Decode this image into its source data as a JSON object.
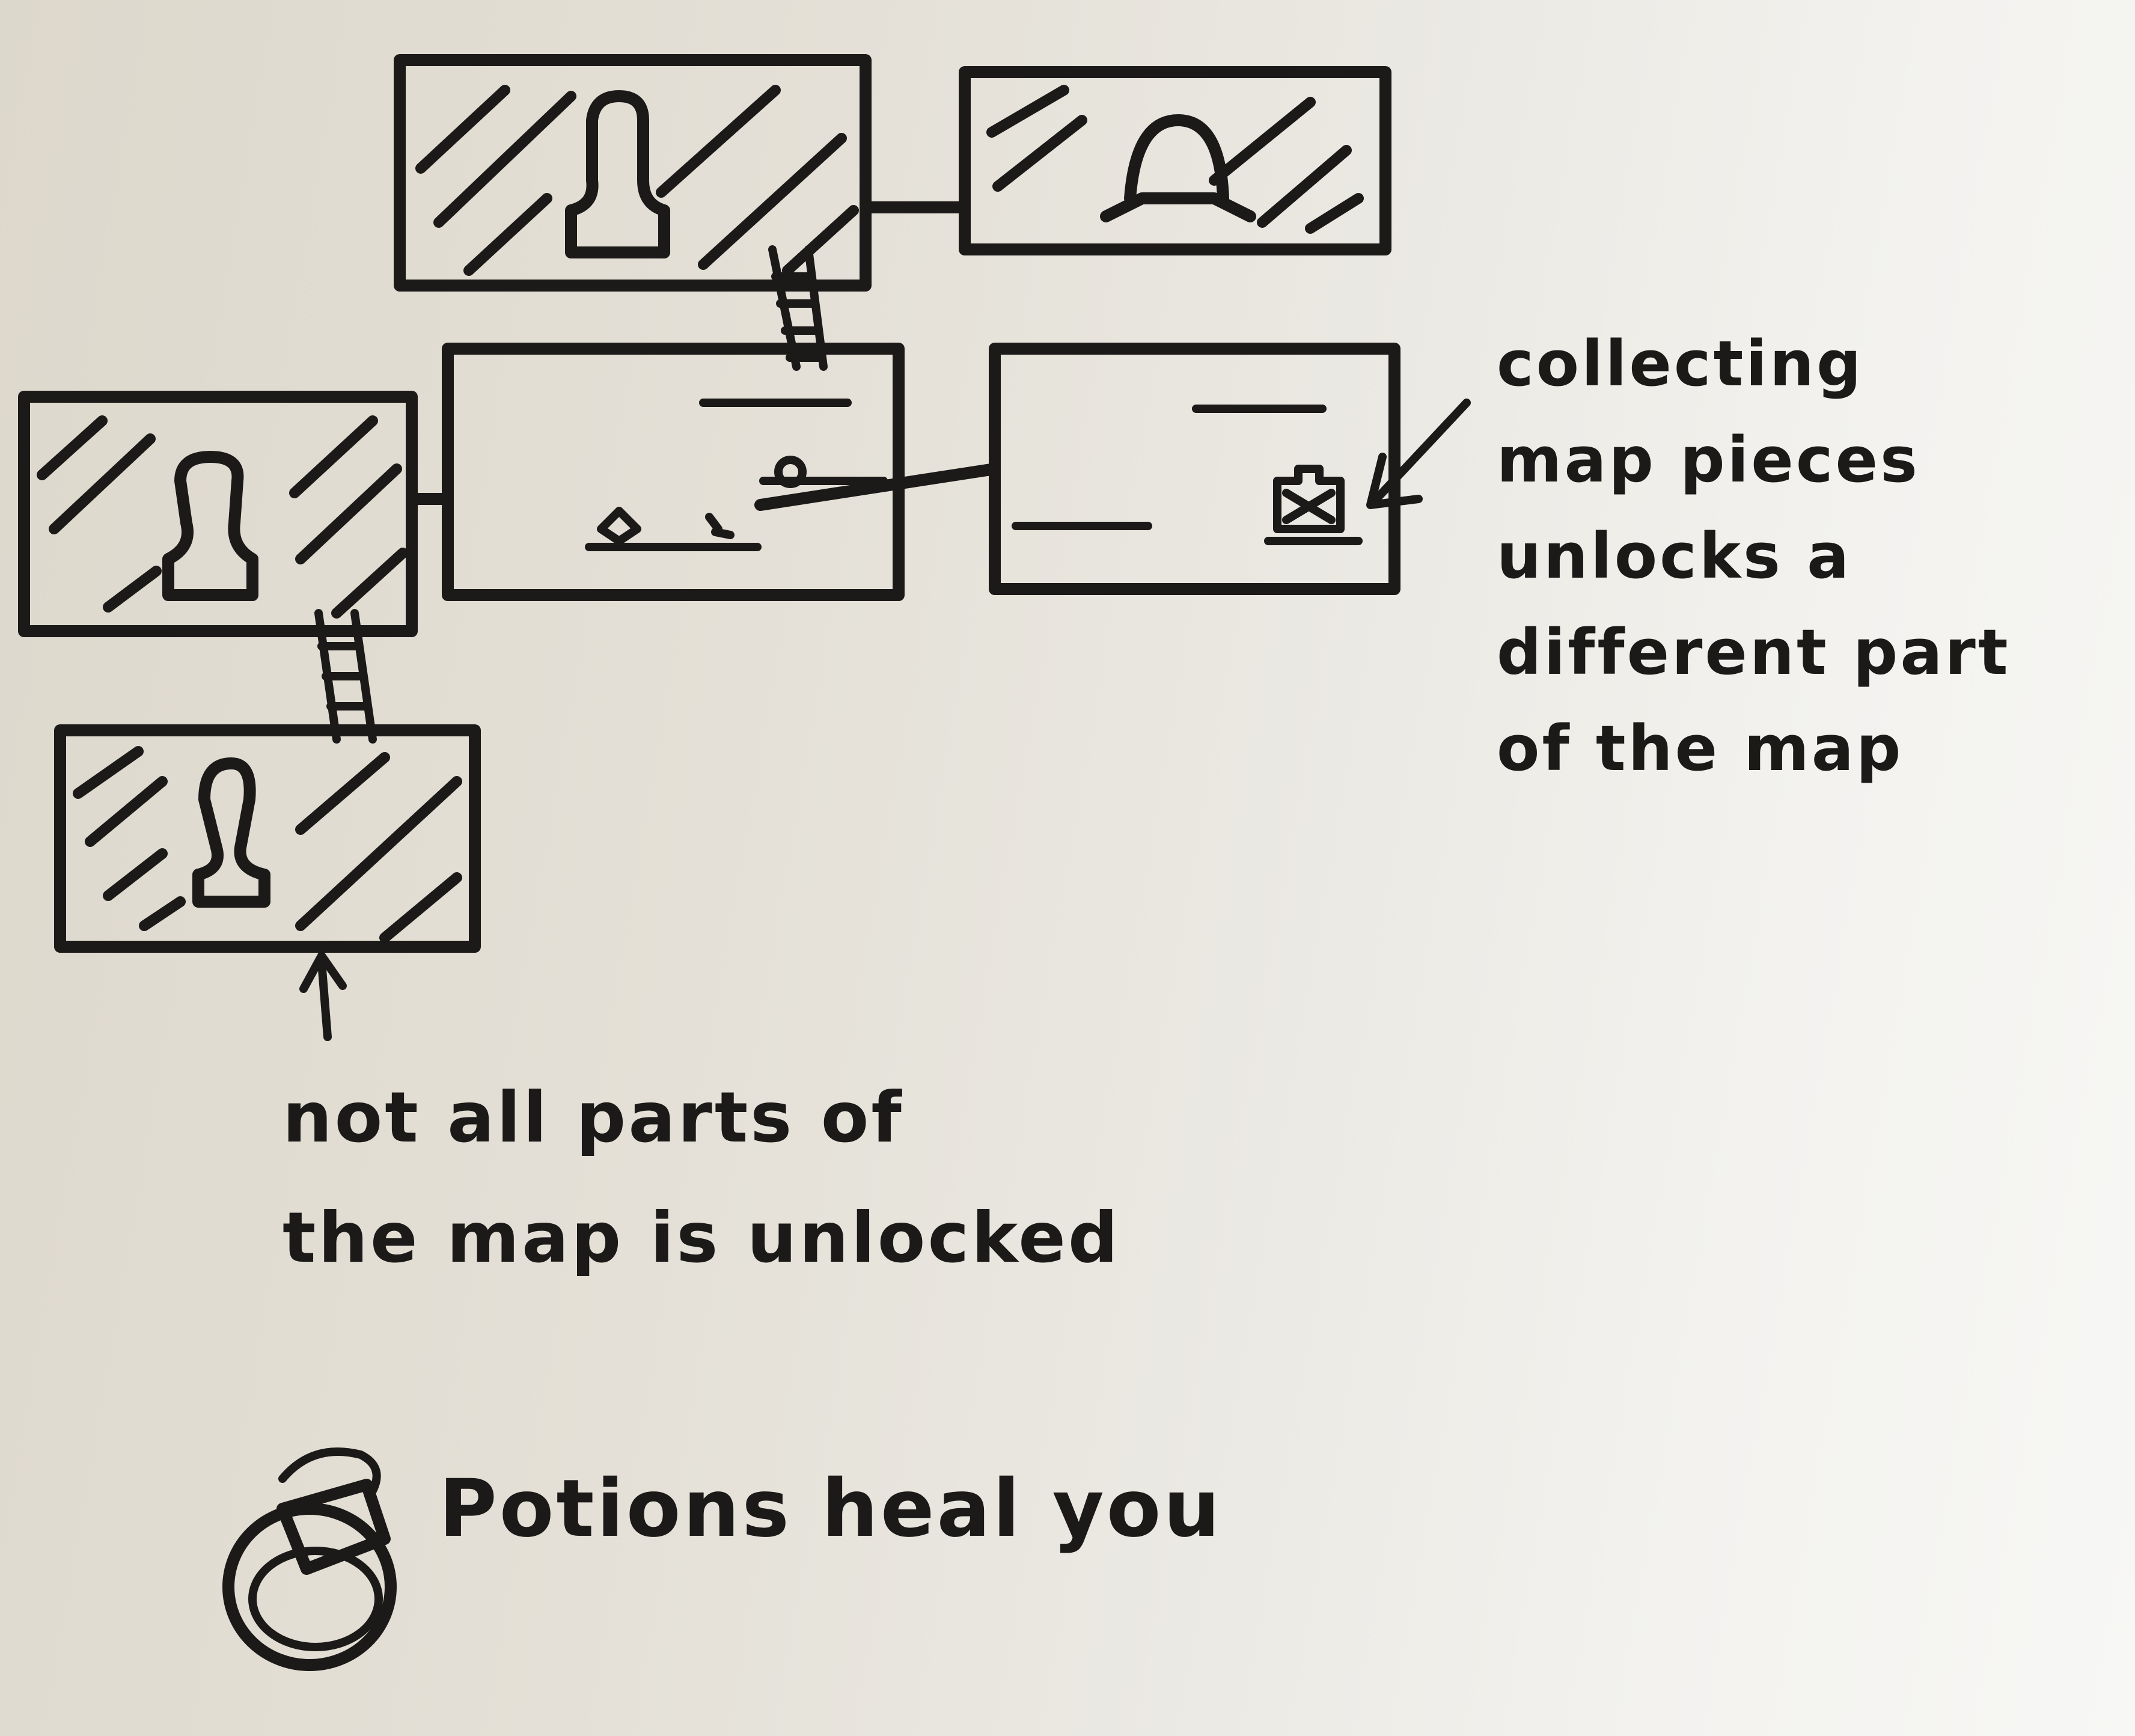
{
  "notes": {
    "map_pieces": {
      "lines": [
        "collecting",
        "map pieces",
        "unlocks a",
        "different part",
        "of the map"
      ]
    },
    "unlocked": {
      "lines": [
        "not all parts of",
        "the map is unlocked"
      ]
    },
    "potions": {
      "text": "Potions heal you"
    }
  },
  "colors": {
    "ink": "#1c1a18",
    "paper": "#e8e5de"
  },
  "icons": [
    "silhouette-icon",
    "ladder-icon",
    "map-piece-icon",
    "coin-icon",
    "potion-icon",
    "arrow-icon"
  ]
}
